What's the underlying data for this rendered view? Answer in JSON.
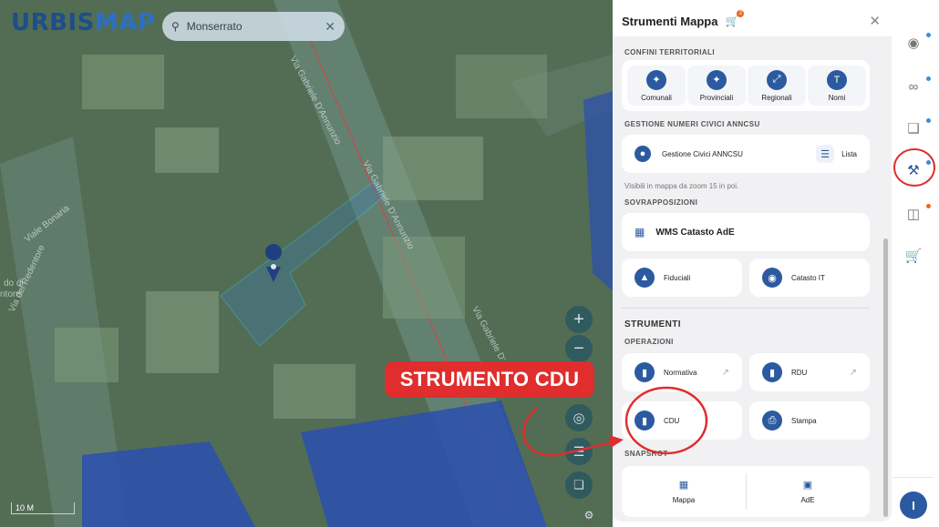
{
  "map": {
    "logo_part1": "URBIS",
    "logo_part2": "MAP",
    "search": {
      "value": "Monserrato",
      "clear_icon": "close-icon"
    },
    "scale_label": "10 M",
    "streets": [
      "Via del Redentore",
      "Via Gabriele D'Annunzio",
      "Via Gabriele D'Annunzio",
      "Viale Bonaria",
      "Via Gabriele D'Annunzio",
      "do di",
      "ntore"
    ],
    "zoom_in": "+",
    "zoom_out": "−"
  },
  "panel": {
    "title": "Strumenti Mappa",
    "cart_badge": "2",
    "sections": {
      "confini": "CONFINI TERRITORIALI",
      "civici": "GESTIONE NUMERI CIVICI ANNCSU",
      "sovrapposizioni": "SOVRAPPOSIZIONI",
      "strumenti": "STRUMENTI",
      "operazioni": "OPERAZIONI",
      "snapshot": "SNAPSHOT"
    },
    "confini_items": [
      "Comunali",
      "Provinciali",
      "Regionali",
      "Nomi"
    ],
    "civici": {
      "gestione": "Gestione Civici ANNCSU",
      "lista": "Lista",
      "note": "Visibili in mappa da zoom 15 in poi."
    },
    "wms": "WMS Catasto AdE",
    "fiduciali": "Fiduciali",
    "catasto_it": "Catasto IT",
    "operazioni": {
      "normativa": "Normativa",
      "rdu": "RDU",
      "cdu": "CDU",
      "stampa": "Stampa"
    },
    "snapshot": {
      "mappa": "Mappa",
      "ade": "AdE"
    }
  },
  "rail": {
    "avatar": "I"
  },
  "annotation": {
    "banner": "STRUMENTO CDU",
    "color": "#e02d2d"
  }
}
